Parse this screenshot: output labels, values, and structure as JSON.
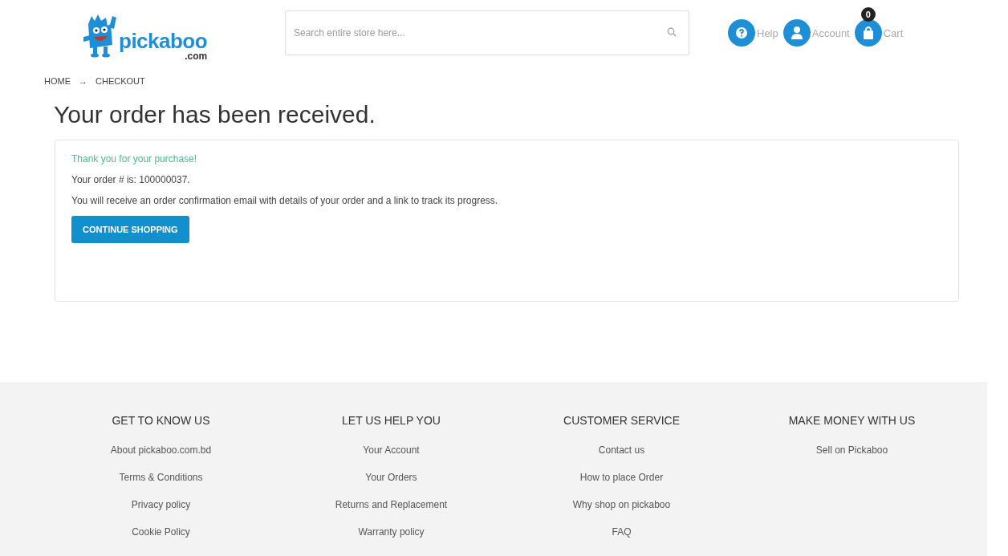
{
  "logo": {
    "name": "pickaboo",
    "suffix": ".com"
  },
  "search": {
    "placeholder": "Search entire store here..."
  },
  "header_links": [
    {
      "kind": "help",
      "label": "Help"
    },
    {
      "kind": "account",
      "label": "Account"
    },
    {
      "kind": "cart",
      "label": "Cart",
      "badge": "0"
    }
  ],
  "breadcrumb": [
    "HOME",
    "CHECKOUT"
  ],
  "breadcrumb_separator": "→",
  "title": "Your order has been received.",
  "order": {
    "thanks": "Thank you for your purchase!",
    "order_number": "Your order # is: 100000037.",
    "message": "You will receive an order confirmation email with details of your order and a link to track its progress.",
    "button": "CONTINUE SHOPPING"
  },
  "footer": [
    {
      "heading": "GET TO KNOW US",
      "links": [
        "About pickaboo.com.bd",
        "Terms & Conditions",
        "Privacy policy",
        "Cookie Policy"
      ]
    },
    {
      "heading": "LET US HELP YOU",
      "links": [
        "Your Account",
        "Your Orders",
        "Returns and Replacement",
        "Warranty policy"
      ]
    },
    {
      "heading": "CUSTOMER SERVICE",
      "links": [
        "Contact us",
        "How to place Order",
        "Why shop on pickaboo",
        "FAQ"
      ]
    },
    {
      "heading": "MAKE MONEY WITH US",
      "links": [
        "Sell on Pickaboo"
      ]
    }
  ]
}
